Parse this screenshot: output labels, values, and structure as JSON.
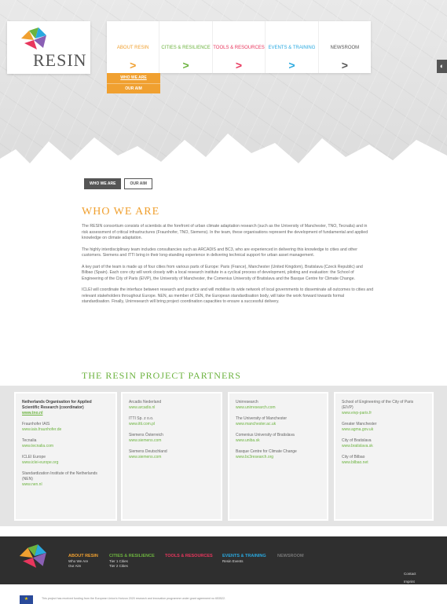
{
  "logo": {
    "brand": "RESIN"
  },
  "nav": {
    "items": [
      {
        "label": "ABOUT RESIN",
        "color": "#f0a030"
      },
      {
        "label": "CITIES & RESILIENCE",
        "color": "#6cb33f"
      },
      {
        "label": "TOOLS & RESOURCES",
        "color": "#e8365d"
      },
      {
        "label": "EVENTS & TRAINING",
        "color": "#29a9e0"
      },
      {
        "label": "NEWSROOM",
        "color": "#555555"
      }
    ],
    "arrow": ">"
  },
  "submenu": {
    "items": [
      "WHO WE ARE",
      "OUR AIM"
    ]
  },
  "tabs": {
    "active": "WHO WE ARE",
    "other": "OUR AIM"
  },
  "content": {
    "title": "WHO WE ARE",
    "paragraphs": [
      "The RESIN consortium consists of scientists at the forefront of urban climate adaptation research (such as the University of Manchester, TNO, Tecnalia) and in risk assessment of critical infrastructures (Fraunhofer, TNO, Siemens). In the team, these organisations represent the development of fundamental and applied knowledge on climate adaptation.",
      "The highly interdisciplinary team includes consultancies such as ARCADIS and BC3, who are experienced in delivering this knowledge to cities and other customers. Siemens and ITTI bring in their long-standing experience in delivering technical support for urban asset management.",
      "A key part of the team is made up of four cities from various parts of Europe: Paris (France), Manchester (United Kingdom), Bratislava (Czeck Republic) and Bilbao (Spain). Each core city will work closely with a local research institute in a cyclical process of development, piloting and evaluation: the School of Engineering of the City of Paris (EIVP), the University of Manchester, the Comenius University of Bratislava and the Basque Centre for Climate Change.",
      "ICLEI will coordinate the interface between research and practice and will mobilise its wide network of local governments to disseminate all outcomes to cities and relevant stakeholders throughout Europe. NEN, as member of CEN, the European standardisation body, will take the work forward towards formal standardisation. Finally, Unirresearch will bring project coordination capacities to ensure a successful delivery."
    ]
  },
  "partners": {
    "title": "THE RESIN PROJECT PARTNERS",
    "columns": [
      [
        {
          "name": "Netherlands Organisation for Applied Scientific Research (coordinator)",
          "url": "www.tno.nl",
          "strong": true
        },
        {
          "name": "Fraunhofer IAIS",
          "url": "www.iais.fraunhofer.de"
        },
        {
          "name": "Tecnalia",
          "url": "www.tecnalia.com"
        },
        {
          "name": "ICLEI Europe",
          "url": "www.iclei-europe.org"
        },
        {
          "name": "Standardization Institute of the Netherlands (NEN)",
          "url": "www.nen.nl"
        }
      ],
      [
        {
          "name": "Arcadis Nederland",
          "url": "www.arcadis.nl"
        },
        {
          "name": "ITTI Sp. z o.o.",
          "url": "www.itti.com.pl"
        },
        {
          "name": "Siemens Österreich",
          "url": "www.siemens.com"
        },
        {
          "name": "Siemens Deutschland",
          "url": "www.siemens.com"
        }
      ],
      [
        {
          "name": "Unirresearch",
          "url": "www.unirresearch.com"
        },
        {
          "name": "The University of Manchester",
          "url": "www.manchester.ac.uk"
        },
        {
          "name": "Comenius University of Bratislava",
          "url": "www.uniba.sk"
        },
        {
          "name": "Basque Centre for Climate Change",
          "url": "www.bc3research.org"
        }
      ],
      [
        {
          "name": "School of Engineering of the City of Paris (EIVP)",
          "url": "www.eivp-paris.fr"
        },
        {
          "name": "Greater Manchester",
          "url": "www.agma.gov.uk"
        },
        {
          "name": "City of Bratislava",
          "url": "www.bratislava.sk"
        },
        {
          "name": "City of Bilbao",
          "url": "www.bilbao.net"
        }
      ]
    ]
  },
  "footer": {
    "columns": [
      {
        "head": "ABOUT RESIN",
        "color": "#f0a030",
        "items": [
          "Who We Are",
          "Our Aim"
        ]
      },
      {
        "head": "CITIES & RESILIENCE",
        "color": "#6cb33f",
        "items": [
          "Tier 1 Cities",
          "Tier 2 Cities"
        ]
      },
      {
        "head": "TOOLS & RESOURCES",
        "color": "#e8365d",
        "items": []
      },
      {
        "head": "EVENTS & TRAINING",
        "color": "#29a9e0",
        "items": [
          "Resin Events"
        ]
      },
      {
        "head": "NEWSROOM",
        "color": "#777777",
        "items": []
      }
    ],
    "links": [
      "Contact",
      "Imprint"
    ]
  },
  "eu_notice": "This project has received funding from the European Union's Horizon 2020 research and innovation programme under grant agreement no 653522."
}
